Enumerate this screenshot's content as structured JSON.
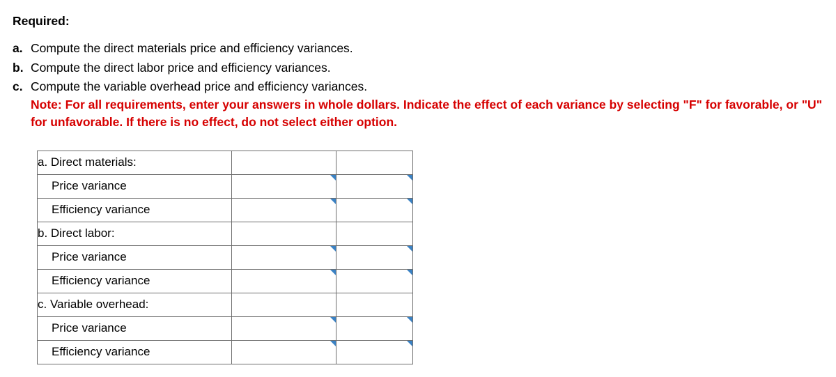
{
  "heading": "Required:",
  "requirements": [
    {
      "marker": "a.",
      "text": "Compute the direct materials price and efficiency variances."
    },
    {
      "marker": "b.",
      "text": "Compute the direct labor price and efficiency variances."
    },
    {
      "marker": "c.",
      "text": "Compute the variable overhead price and efficiency variances."
    }
  ],
  "note": "Note: For all requirements, enter your answers in whole dollars. Indicate the effect of each variance by selecting \"F\" for favorable, or \"U\" for unfavorable. If there is no effect, do not select either option.",
  "table": {
    "rows": [
      {
        "label": "a. Direct materials:",
        "type": "header"
      },
      {
        "label": "Price variance",
        "type": "input"
      },
      {
        "label": "Efficiency variance",
        "type": "input"
      },
      {
        "label": "b. Direct labor:",
        "type": "header"
      },
      {
        "label": "Price variance",
        "type": "input"
      },
      {
        "label": "Efficiency variance",
        "type": "input"
      },
      {
        "label": "c. Variable overhead:",
        "type": "header"
      },
      {
        "label": "Price variance",
        "type": "input"
      },
      {
        "label": "Efficiency variance",
        "type": "input"
      }
    ]
  }
}
